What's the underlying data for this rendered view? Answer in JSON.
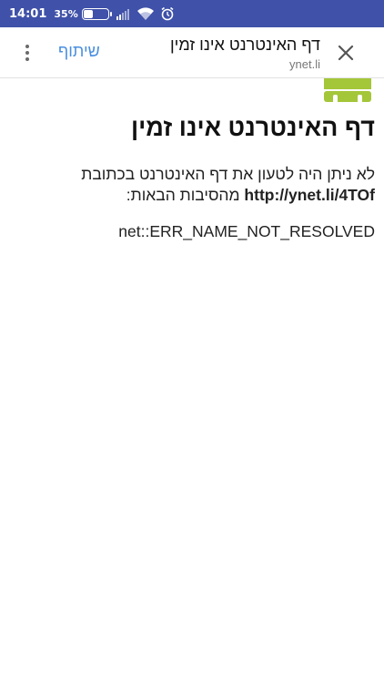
{
  "status_bar": {
    "time": "14:01",
    "battery_percent": "35%",
    "battery_level": 0.35,
    "signal_bars_on": 2,
    "icons": [
      "battery-icon",
      "signal-icon",
      "wifi-icon",
      "alarm-icon"
    ]
  },
  "toolbar": {
    "menu_icon": "more-vertical-icon",
    "share_label": "שיתוף",
    "title": "דף האינטרנט אינו זמין",
    "domain": "ynet.li",
    "close_icon": "close-icon",
    "accent_color": "#4a8fe0"
  },
  "content": {
    "icon": "android-icon",
    "heading": "דף האינטרנט אינו זמין",
    "message_prefix": "לא ניתן היה לטעון את דף האינטרנט בכתובת",
    "url": "http://ynet.li/4TOf",
    "message_suffix": "מהסיבות הבאות:",
    "error_code": "net::ERR_NAME_NOT_RESOLVED"
  },
  "colors": {
    "status_bar": "#3f51a8",
    "android_green": "#a4c639"
  }
}
